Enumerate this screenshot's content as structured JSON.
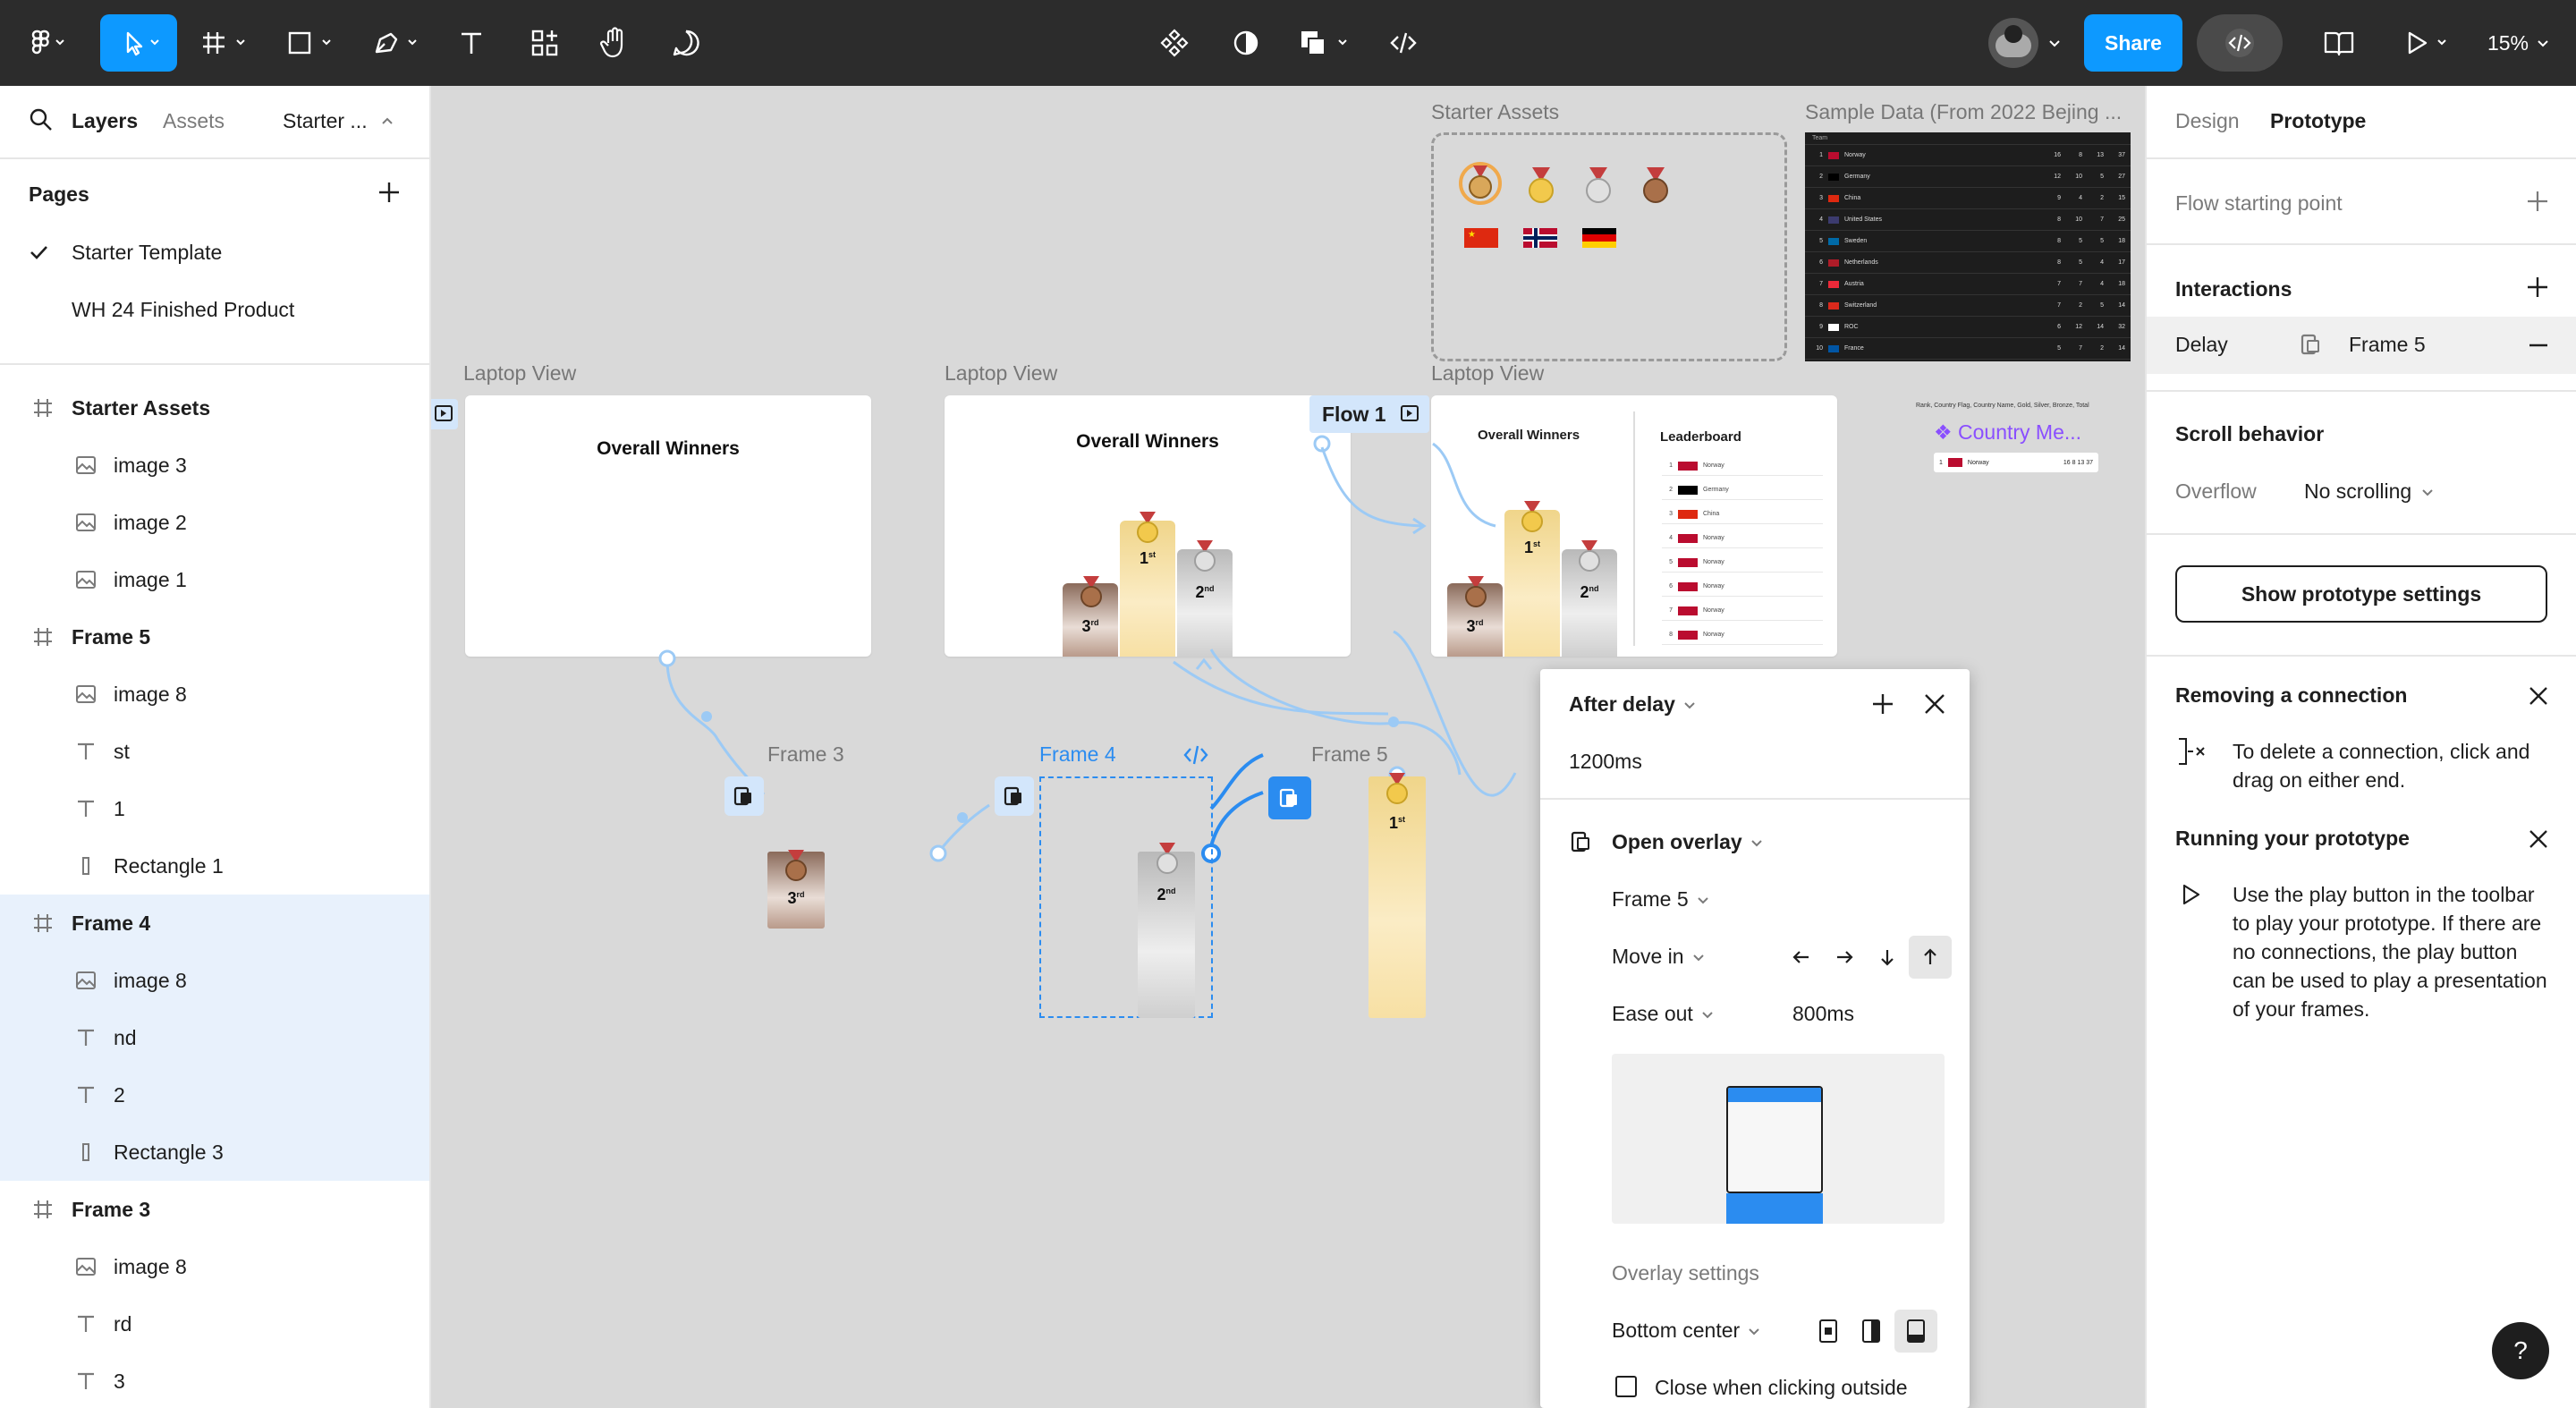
{
  "toolbar": {
    "zoom": "15%",
    "share": "Share"
  },
  "left_panel": {
    "tabs": [
      "Layers",
      "Assets"
    ],
    "page_picker": "Starter ...",
    "pages_title": "Pages",
    "pages": [
      "Starter Template",
      "WH 24 Finished Product"
    ],
    "layers": [
      {
        "label": "Starter Assets",
        "type": "frame"
      },
      {
        "label": "image 3",
        "type": "image"
      },
      {
        "label": "image 2",
        "type": "image"
      },
      {
        "label": "image 1",
        "type": "image"
      },
      {
        "label": "Frame 5",
        "type": "frame"
      },
      {
        "label": "image 8",
        "type": "image"
      },
      {
        "label": "st",
        "type": "text"
      },
      {
        "label": "1",
        "type": "text"
      },
      {
        "label": "Rectangle 1",
        "type": "rect"
      },
      {
        "label": "Frame 4",
        "type": "frame",
        "selected": true
      },
      {
        "label": "image 8",
        "type": "image",
        "selected": true
      },
      {
        "label": "nd",
        "type": "text",
        "selected": true
      },
      {
        "label": "2",
        "type": "text",
        "selected": true
      },
      {
        "label": "Rectangle 3",
        "type": "rect",
        "selected": true
      },
      {
        "label": "Frame 3",
        "type": "frame"
      },
      {
        "label": "image 8",
        "type": "image"
      },
      {
        "label": "rd",
        "type": "text"
      },
      {
        "label": "3",
        "type": "text"
      }
    ]
  },
  "canvas": {
    "labels": {
      "starter_assets": "Starter Assets",
      "sample_data": "Sample Data (From 2022 Bejing ...",
      "laptop1": "Laptop View",
      "laptop2": "Laptop View",
      "laptop3": "Laptop View",
      "frame3": "Frame 3",
      "frame4": "Frame 4",
      "frame5": "Frame 5",
      "flow": "Flow 1",
      "country": "❖ Country Me...",
      "country_header": "Rank, Country Flag, Country Name, Gold, Silver, Bronze, Total"
    },
    "overall_winners": "Overall Winners",
    "leaderboard": "Leaderboard",
    "podium": {
      "first": "1",
      "second": "2",
      "third": "3",
      "first_sup": "st",
      "second_sup": "nd",
      "third_sup": "rd"
    },
    "country_row": {
      "rank": "1",
      "name": "Norway",
      "nums": "16  8  13  37"
    },
    "sample_rows": [
      {
        "rank": "1",
        "name": "Norway",
        "n": [
          "16",
          "8",
          "13",
          "37"
        ]
      },
      {
        "rank": "2",
        "name": "Germany",
        "n": [
          "12",
          "10",
          "5",
          "27"
        ]
      },
      {
        "rank": "3",
        "name": "China",
        "n": [
          "9",
          "4",
          "2",
          "15"
        ]
      },
      {
        "rank": "4",
        "name": "United States",
        "n": [
          "8",
          "10",
          "7",
          "25"
        ]
      },
      {
        "rank": "5",
        "name": "Sweden",
        "n": [
          "8",
          "5",
          "5",
          "18"
        ]
      },
      {
        "rank": "6",
        "name": "Netherlands",
        "n": [
          "8",
          "5",
          "4",
          "17"
        ]
      },
      {
        "rank": "7",
        "name": "Austria",
        "n": [
          "7",
          "7",
          "4",
          "18"
        ]
      },
      {
        "rank": "8",
        "name": "Switzerland",
        "n": [
          "7",
          "2",
          "5",
          "14"
        ]
      },
      {
        "rank": "9",
        "name": "ROC",
        "n": [
          "6",
          "12",
          "14",
          "32"
        ]
      },
      {
        "rank": "10",
        "name": "France",
        "n": [
          "5",
          "7",
          "2",
          "14"
        ]
      }
    ],
    "leader_rows": [
      {
        "rank": "1",
        "name": "Norway"
      },
      {
        "rank": "2",
        "name": "Germany"
      },
      {
        "rank": "3",
        "name": "China"
      },
      {
        "rank": "4",
        "name": "Norway"
      },
      {
        "rank": "5",
        "name": "Norway"
      },
      {
        "rank": "6",
        "name": "Norway"
      },
      {
        "rank": "7",
        "name": "Norway"
      },
      {
        "rank": "8",
        "name": "Norway"
      }
    ]
  },
  "overlay_panel": {
    "trigger": "After delay",
    "delay": "1200ms",
    "action": "Open overlay",
    "destination": "Frame 5",
    "animation": "Move in",
    "easing": "Ease out",
    "duration": "800ms",
    "overlay_settings": "Overlay settings",
    "position": "Bottom center",
    "close_outside": "Close when clicking outside"
  },
  "right_panel": {
    "tabs": [
      "Design",
      "Prototype"
    ],
    "flow_start": "Flow starting point",
    "interactions": "Interactions",
    "interaction": {
      "trigger": "Delay",
      "target": "Frame 5"
    },
    "scroll_behavior": "Scroll behavior",
    "overflow_label": "Overflow",
    "overflow_value": "No scrolling",
    "show_settings": "Show prototype settings",
    "removing_title": "Removing a connection",
    "removing_text": "To delete a connection, click and drag on either end.",
    "running_title": "Running your prototype",
    "running_text": "Use the play button in the toolbar to play your prototype. If there are no connections, the play button can be used to play a presentation of your frames."
  },
  "help": "?"
}
